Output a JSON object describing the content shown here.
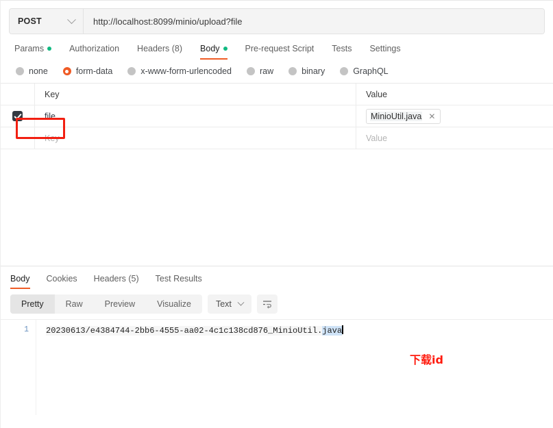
{
  "request": {
    "method": "POST",
    "method_icon": "chevron-down-icon",
    "url": "http://localhost:8099/minio/upload?file",
    "url_placeholder": "Enter request URL",
    "tabs": [
      {
        "label": "Params",
        "dot": true,
        "active": false
      },
      {
        "label": "Authorization",
        "dot": false,
        "active": false
      },
      {
        "label": "Headers (8)",
        "dot": false,
        "active": false
      },
      {
        "label": "Body",
        "dot": true,
        "active": true
      },
      {
        "label": "Pre-request Script",
        "dot": false,
        "active": false
      },
      {
        "label": "Tests",
        "dot": false,
        "active": false
      },
      {
        "label": "Settings",
        "dot": false,
        "active": false
      }
    ],
    "body_types": [
      {
        "label": "none",
        "selected": false
      },
      {
        "label": "form-data",
        "selected": true
      },
      {
        "label": "x-www-form-urlencoded",
        "selected": false
      },
      {
        "label": "raw",
        "selected": false
      },
      {
        "label": "binary",
        "selected": false
      },
      {
        "label": "GraphQL",
        "selected": false
      }
    ],
    "table": {
      "headers": {
        "key": "Key",
        "value": "Value"
      },
      "rows": [
        {
          "checked": true,
          "key": "file",
          "value_file": "MinioUtil.java",
          "value_remove_icon": "close-icon"
        }
      ],
      "empty_row": {
        "key_placeholder": "Key",
        "value_placeholder": "Value"
      }
    }
  },
  "response": {
    "tabs": [
      {
        "label": "Body",
        "active": true
      },
      {
        "label": "Cookies",
        "active": false
      },
      {
        "label": "Headers (5)",
        "active": false
      },
      {
        "label": "Test Results",
        "active": false
      }
    ],
    "format_buttons": [
      {
        "label": "Pretty",
        "active": true
      },
      {
        "label": "Raw",
        "active": false
      },
      {
        "label": "Preview",
        "active": false
      },
      {
        "label": "Visualize",
        "active": false
      }
    ],
    "language_select": {
      "value": "Text",
      "icon": "chevron-down-icon"
    },
    "wrap_button_icon": "wrap-lines-icon",
    "body": {
      "line_number": "1",
      "text_before_selection": "20230613/e4384744-2bb6-4555-aa02-4c1c138cd876_MinioUtil.",
      "selected_text": "java",
      "full_text": "20230613/e4384744-2bb6-4555-aa02-4c1c138cd876_MinioUtil.java"
    }
  },
  "annotations": {
    "highlight_box_target": "file-key-checkbox",
    "note_text": "下载id"
  },
  "colors": {
    "accent_orange": "#ef5b25",
    "status_green": "#10b981",
    "annotation_red": "#f21f11",
    "selection_blue": "#cfe3f7",
    "toolbar_gray": "#f3f3f3"
  }
}
